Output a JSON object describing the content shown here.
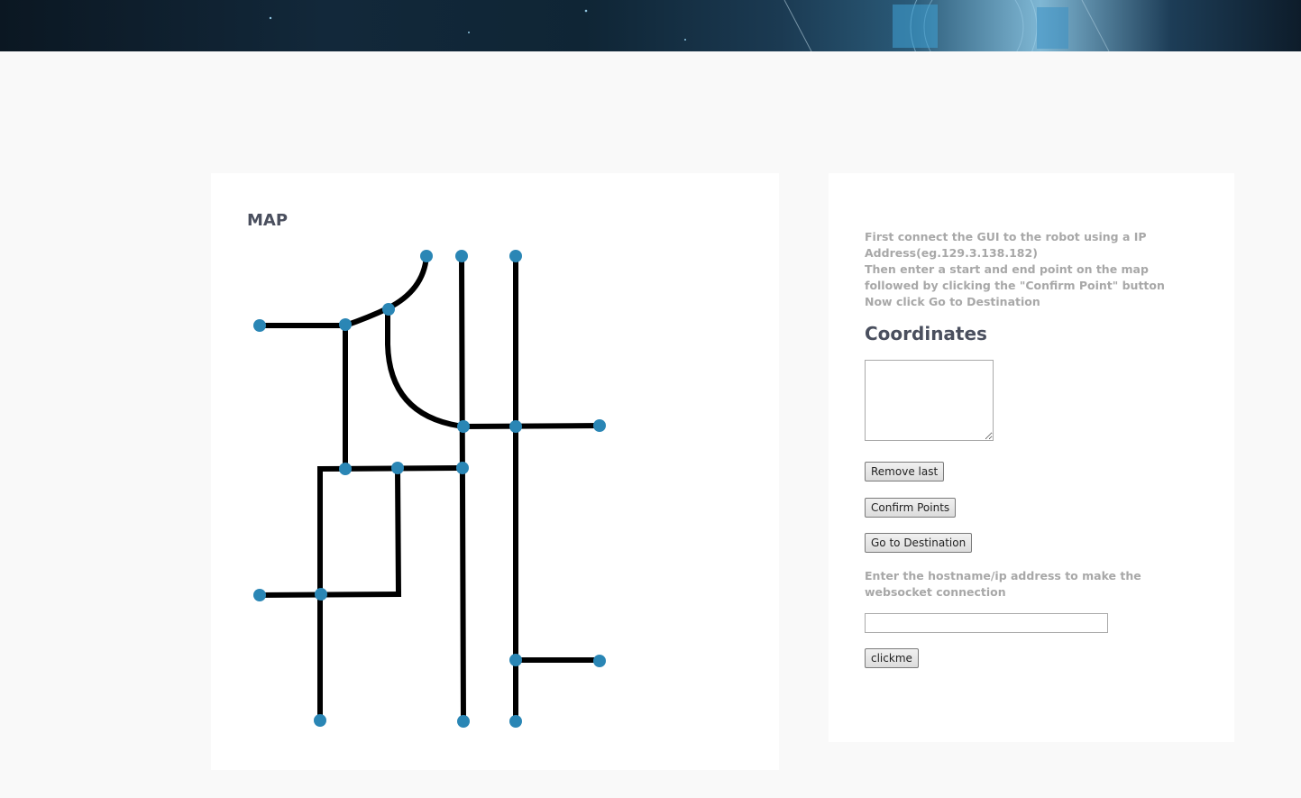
{
  "map": {
    "title": "MAP"
  },
  "instructions": {
    "line1": "First connect the GUI to the robot using a IP Address(eg.129.3.138.182)",
    "line2": "Then enter a start and end point on the map followed by clicking the \"Confirm Point\" button",
    "line3": "Now click Go to Destination"
  },
  "coordinates": {
    "title": "Coordinates",
    "value": ""
  },
  "buttons": {
    "remove_last": "Remove last",
    "confirm_points": "Confirm Points",
    "go_to_destination": "Go to Destination",
    "clickme": "clickme"
  },
  "websocket": {
    "label": "Enter the hostname/ip address to make the websocket connection",
    "value": ""
  },
  "colors": {
    "node": "#2a86b5",
    "road": "#000000",
    "heading": "#4a4f5e",
    "instruction_text": "#a8a8a8"
  }
}
